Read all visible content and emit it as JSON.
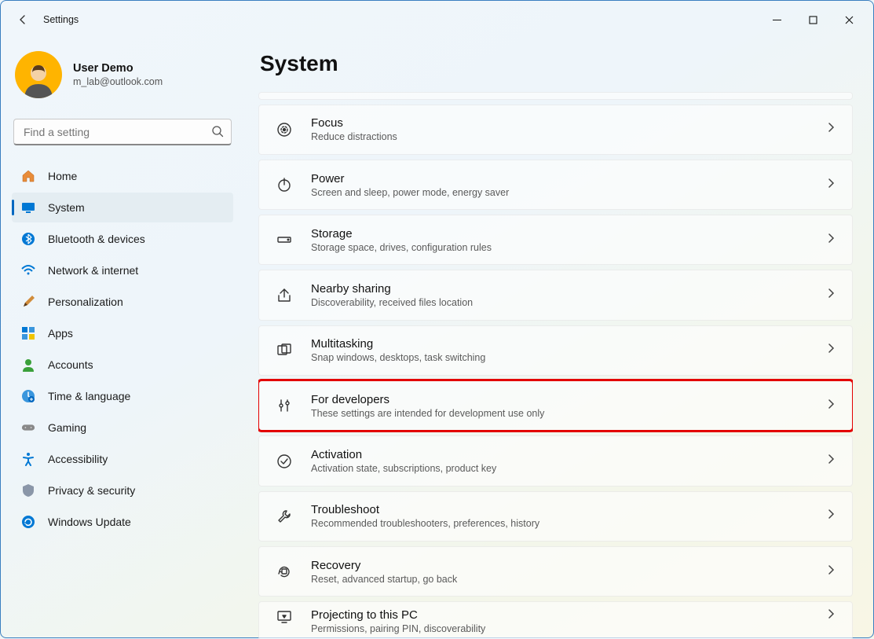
{
  "window": {
    "title": "Settings"
  },
  "user": {
    "name": "User Demo",
    "email": "m_lab@outlook.com"
  },
  "search": {
    "placeholder": "Find a setting"
  },
  "nav": [
    {
      "label": "Home",
      "icon": "home"
    },
    {
      "label": "System",
      "icon": "system",
      "active": true
    },
    {
      "label": "Bluetooth & devices",
      "icon": "bluetooth"
    },
    {
      "label": "Network & internet",
      "icon": "wifi"
    },
    {
      "label": "Personalization",
      "icon": "brush"
    },
    {
      "label": "Apps",
      "icon": "apps"
    },
    {
      "label": "Accounts",
      "icon": "person"
    },
    {
      "label": "Time & language",
      "icon": "clock"
    },
    {
      "label": "Gaming",
      "icon": "gamepad"
    },
    {
      "label": "Accessibility",
      "icon": "accessibility"
    },
    {
      "label": "Privacy & security",
      "icon": "shield"
    },
    {
      "label": "Windows Update",
      "icon": "update"
    }
  ],
  "page": {
    "title": "System"
  },
  "cards": [
    {
      "title": "Focus",
      "sub": "Reduce distractions",
      "icon": "focus"
    },
    {
      "title": "Power",
      "sub": "Screen and sleep, power mode, energy saver",
      "icon": "power"
    },
    {
      "title": "Storage",
      "sub": "Storage space, drives, configuration rules",
      "icon": "storage"
    },
    {
      "title": "Nearby sharing",
      "sub": "Discoverability, received files location",
      "icon": "share"
    },
    {
      "title": "Multitasking",
      "sub": "Snap windows, desktops, task switching",
      "icon": "multitask"
    },
    {
      "title": "For developers",
      "sub": "These settings are intended for development use only",
      "icon": "dev",
      "highlight": true
    },
    {
      "title": "Activation",
      "sub": "Activation state, subscriptions, product key",
      "icon": "activation"
    },
    {
      "title": "Troubleshoot",
      "sub": "Recommended troubleshooters, preferences, history",
      "icon": "wrench"
    },
    {
      "title": "Recovery",
      "sub": "Reset, advanced startup, go back",
      "icon": "recovery"
    },
    {
      "title": "Projecting to this PC",
      "sub": "Permissions, pairing PIN, discoverability",
      "icon": "project"
    }
  ]
}
